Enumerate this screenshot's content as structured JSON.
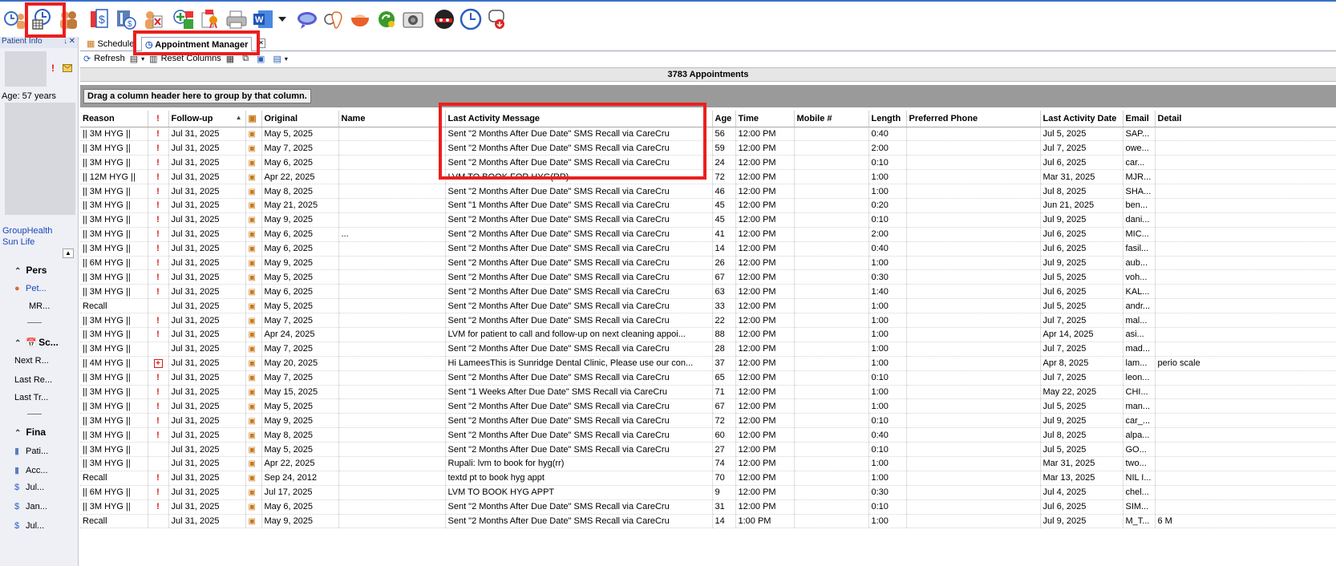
{
  "toolbar": {
    "icons": [
      "clock-person-icon",
      "appointment-manager-icon",
      "patient-icon",
      "billing-icon",
      "insurance-icon",
      "treatment-icon",
      "add-patient-icon",
      "certificate-icon",
      "printer-icon",
      "word-icon",
      "dropdown-icon",
      "chat-icon",
      "tooth-icon",
      "bowl-icon",
      "refresh-icon",
      "camera-icon",
      "mask-icon",
      "clock-icon",
      "phone-icon"
    ]
  },
  "left_panel": {
    "title": "Patient Info",
    "pin": "↓",
    "close": "✕",
    "alert": "!",
    "age": "Age: 57 years",
    "insurance": [
      "GroupHealth",
      "Sun Life"
    ],
    "sections": [
      {
        "label": "Pers",
        "items": [
          {
            "label": "Pet...",
            "link": true,
            "icon": "person-icon"
          },
          {
            "label": "MR...",
            "link": false,
            "icon": ""
          }
        ]
      },
      {
        "label": "Sc...",
        "items": [
          {
            "label": "Next R...",
            "link": false,
            "icon": ""
          },
          {
            "label": "Last Re...",
            "link": false,
            "icon": ""
          },
          {
            "label": "Last Tr...",
            "link": false,
            "icon": ""
          }
        ]
      },
      {
        "label": "Fina",
        "items": [
          {
            "label": "Pati...",
            "link": false,
            "icon": "ledger-icon"
          },
          {
            "label": "Acc...",
            "link": false,
            "icon": "ledger-icon"
          },
          {
            "label": "Jul...",
            "link": false,
            "icon": "statement-icon"
          },
          {
            "label": "Jan...",
            "link": false,
            "icon": "statement-icon"
          },
          {
            "label": "Jul...",
            "link": false,
            "icon": "statement-icon"
          }
        ]
      }
    ]
  },
  "tabs": {
    "schedule": "Schedule",
    "appointment_manager": "Appointment Manager",
    "close": "✕"
  },
  "actions": {
    "refresh": "Refresh",
    "reset_columns": "Reset Columns"
  },
  "count": "3783 Appointments",
  "group_hint": "Drag a column header here to group by that column.",
  "columns": [
    "Reason",
    "!",
    "Follow-up",
    "",
    "Original",
    "Name",
    "Last Activity Message",
    "Age",
    "Time",
    "Mobile #",
    "Length",
    "Preferred Phone",
    "Last Activity Date",
    "Email",
    "Detail"
  ],
  "rows": [
    {
      "reason": "|| 3M HYG ||",
      "flag": "!",
      "followup": "Jul 31, 2025",
      "original": "May 5, 2025",
      "name": "",
      "message": "Sent \"2 Months After Due Date\" SMS Recall via CareCru",
      "age": "56",
      "time": "12:00 PM",
      "mobile": "",
      "length": "0:40",
      "phone": "",
      "last_date": "Jul 5, 2025",
      "email": "SAP...",
      "detail": ""
    },
    {
      "reason": "|| 3M HYG ||",
      "flag": "!",
      "followup": "Jul 31, 2025",
      "original": "May 7, 2025",
      "name": "",
      "message": "Sent \"2 Months After Due Date\" SMS Recall via CareCru",
      "age": "59",
      "time": "12:00 PM",
      "mobile": "",
      "length": "2:00",
      "phone": "",
      "last_date": "Jul 7, 2025",
      "email": "owe...",
      "detail": ""
    },
    {
      "reason": "|| 3M HYG ||",
      "flag": "!",
      "followup": "Jul 31, 2025",
      "original": "May 6, 2025",
      "name": "",
      "message": "Sent \"2 Months After Due Date\" SMS Recall via CareCru",
      "age": "24",
      "time": "12:00 PM",
      "mobile": "",
      "length": "0:10",
      "phone": "",
      "last_date": "Jul 6, 2025",
      "email": "car...",
      "detail": ""
    },
    {
      "reason": "|| 12M HYG ||",
      "flag": "!",
      "followup": "Jul 31, 2025",
      "original": "Apr 22, 2025",
      "name": "",
      "message": "LVM TO BOOK FOR HYG(RR)",
      "age": "72",
      "time": "12:00 PM",
      "mobile": "",
      "length": "1:00",
      "phone": "",
      "last_date": "Mar 31, 2025",
      "email": "MJR...",
      "detail": ""
    },
    {
      "reason": "|| 3M HYG ||",
      "flag": "!",
      "followup": "Jul 31, 2025",
      "original": "May 8, 2025",
      "name": "",
      "message": "Sent \"2 Months After Due Date\" SMS Recall via CareCru",
      "age": "46",
      "time": "12:00 PM",
      "mobile": "",
      "length": "1:00",
      "phone": "",
      "last_date": "Jul 8, 2025",
      "email": "SHA...",
      "detail": ""
    },
    {
      "reason": "|| 3M HYG ||",
      "flag": "!",
      "followup": "Jul 31, 2025",
      "original": "May 21, 2025",
      "name": "",
      "message": "Sent \"1 Months After Due Date\" SMS Recall via CareCru",
      "age": "45",
      "time": "12:00 PM",
      "mobile": "",
      "length": "0:20",
      "phone": "",
      "last_date": "Jun 21, 2025",
      "email": "ben...",
      "detail": ""
    },
    {
      "reason": "|| 3M HYG ||",
      "flag": "!",
      "followup": "Jul 31, 2025",
      "original": "May 9, 2025",
      "name": "",
      "message": "Sent \"2 Months After Due Date\" SMS Recall via CareCru",
      "age": "45",
      "time": "12:00 PM",
      "mobile": "",
      "length": "0:10",
      "phone": "",
      "last_date": "Jul 9, 2025",
      "email": "dani...",
      "detail": ""
    },
    {
      "reason": "|| 3M HYG ||",
      "flag": "!",
      "followup": "Jul 31, 2025",
      "original": "May 6, 2025",
      "name": "...",
      "message": "Sent \"2 Months After Due Date\" SMS Recall via CareCru",
      "age": "41",
      "time": "12:00 PM",
      "mobile": "",
      "length": "2:00",
      "phone": "",
      "last_date": "Jul 6, 2025",
      "email": "MIC...",
      "detail": ""
    },
    {
      "reason": "|| 3M HYG ||",
      "flag": "!",
      "followup": "Jul 31, 2025",
      "original": "May 6, 2025",
      "name": "",
      "message": "Sent \"2 Months After Due Date\" SMS Recall via CareCru",
      "age": "14",
      "time": "12:00 PM",
      "mobile": "",
      "length": "0:40",
      "phone": "",
      "last_date": "Jul 6, 2025",
      "email": "fasil...",
      "detail": ""
    },
    {
      "reason": "|| 6M HYG ||",
      "flag": "!",
      "followup": "Jul 31, 2025",
      "original": "May 9, 2025",
      "name": "",
      "message": "Sent \"2 Months After Due Date\" SMS Recall via CareCru",
      "age": "26",
      "time": "12:00 PM",
      "mobile": "",
      "length": "1:00",
      "phone": "",
      "last_date": "Jul 9, 2025",
      "email": "aub...",
      "detail": ""
    },
    {
      "reason": "|| 3M HYG ||",
      "flag": "!",
      "followup": "Jul 31, 2025",
      "original": "May 5, 2025",
      "name": "",
      "message": "Sent \"2 Months After Due Date\" SMS Recall via CareCru",
      "age": "67",
      "time": "12:00 PM",
      "mobile": "",
      "length": "0:30",
      "phone": "",
      "last_date": "Jul 5, 2025",
      "email": "voh...",
      "detail": ""
    },
    {
      "reason": "|| 3M HYG ||",
      "flag": "!",
      "followup": "Jul 31, 2025",
      "original": "May 6, 2025",
      "name": "",
      "message": "Sent \"2 Months After Due Date\" SMS Recall via CareCru",
      "age": "63",
      "time": "12:00 PM",
      "mobile": "",
      "length": "1:40",
      "phone": "",
      "last_date": "Jul 6, 2025",
      "email": "KAL...",
      "detail": ""
    },
    {
      "reason": "Recall",
      "flag": "",
      "followup": "Jul 31, 2025",
      "original": "May 5, 2025",
      "name": "",
      "message": "Sent \"2 Months After Due Date\" SMS Recall via CareCru",
      "age": "33",
      "time": "12:00 PM",
      "mobile": "",
      "length": "1:00",
      "phone": "",
      "last_date": "Jul 5, 2025",
      "email": "andr...",
      "detail": ""
    },
    {
      "reason": "|| 3M HYG ||",
      "flag": "!",
      "followup": "Jul 31, 2025",
      "original": "May 7, 2025",
      "name": "",
      "message": "Sent \"2 Months After Due Date\" SMS Recall via CareCru",
      "age": "22",
      "time": "12:00 PM",
      "mobile": "",
      "length": "1:00",
      "phone": "",
      "last_date": "Jul 7, 2025",
      "email": "mal...",
      "detail": ""
    },
    {
      "reason": "|| 3M HYG ||",
      "flag": "!",
      "followup": "Jul 31, 2025",
      "original": "Apr 24, 2025",
      "name": "",
      "message": "LVM for patient to call and follow-up on next cleaning appoi...",
      "age": "88",
      "time": "12:00 PM",
      "mobile": "",
      "length": "1:00",
      "phone": "",
      "last_date": "Apr 14, 2025",
      "email": "asi...",
      "detail": ""
    },
    {
      "reason": "|| 3M HYG ||",
      "flag": "",
      "followup": "Jul 31, 2025",
      "original": "May 7, 2025",
      "name": "",
      "message": "Sent \"2 Months After Due Date\" SMS Recall via CareCru",
      "age": "28",
      "time": "12:00 PM",
      "mobile": "",
      "length": "1:00",
      "phone": "",
      "last_date": "Jul 7, 2025",
      "email": "mad...",
      "detail": ""
    },
    {
      "reason": "|| 4M HYG ||",
      "flag": "+",
      "followup": "Jul 31, 2025",
      "original": "May 20, 2025",
      "name": "",
      "message": "Hi LameesThis is Sunridge Dental Clinic, Please use our con...",
      "age": "37",
      "time": "12:00 PM",
      "mobile": "",
      "length": "1:00",
      "phone": "",
      "last_date": "Apr 8, 2025",
      "email": "lam...",
      "detail": "perio scale"
    },
    {
      "reason": "|| 3M HYG ||",
      "flag": "!",
      "followup": "Jul 31, 2025",
      "original": "May 7, 2025",
      "name": "",
      "message": "Sent \"2 Months After Due Date\" SMS Recall via CareCru",
      "age": "65",
      "time": "12:00 PM",
      "mobile": "",
      "length": "0:10",
      "phone": "",
      "last_date": "Jul 7, 2025",
      "email": "leon...",
      "detail": ""
    },
    {
      "reason": "|| 3M HYG ||",
      "flag": "!",
      "followup": "Jul 31, 2025",
      "original": "May 15, 2025",
      "name": "",
      "message": "Sent \"1 Weeks After Due Date\" SMS Recall via CareCru",
      "age": "71",
      "time": "12:00 PM",
      "mobile": "",
      "length": "1:00",
      "phone": "",
      "last_date": "May 22, 2025",
      "email": "CHI...",
      "detail": ""
    },
    {
      "reason": "|| 3M HYG ||",
      "flag": "!",
      "followup": "Jul 31, 2025",
      "original": "May 5, 2025",
      "name": "",
      "message": "Sent \"2 Months After Due Date\" SMS Recall via CareCru",
      "age": "67",
      "time": "12:00 PM",
      "mobile": "",
      "length": "1:00",
      "phone": "",
      "last_date": "Jul 5, 2025",
      "email": "man...",
      "detail": ""
    },
    {
      "reason": "|| 3M HYG ||",
      "flag": "!",
      "followup": "Jul 31, 2025",
      "original": "May 9, 2025",
      "name": "",
      "message": "Sent \"2 Months After Due Date\" SMS Recall via CareCru",
      "age": "72",
      "time": "12:00 PM",
      "mobile": "",
      "length": "0:10",
      "phone": "",
      "last_date": "Jul 9, 2025",
      "email": "car_...",
      "detail": ""
    },
    {
      "reason": "|| 3M HYG ||",
      "flag": "!",
      "followup": "Jul 31, 2025",
      "original": "May 8, 2025",
      "name": "",
      "message": "Sent \"2 Months After Due Date\" SMS Recall via CareCru",
      "age": "60",
      "time": "12:00 PM",
      "mobile": "",
      "length": "0:40",
      "phone": "",
      "last_date": "Jul 8, 2025",
      "email": "alpa...",
      "detail": ""
    },
    {
      "reason": "|| 3M HYG ||",
      "flag": "",
      "followup": "Jul 31, 2025",
      "original": "May 5, 2025",
      "name": "",
      "message": "Sent \"2 Months After Due Date\" SMS Recall via CareCru",
      "age": "27",
      "time": "12:00 PM",
      "mobile": "",
      "length": "0:10",
      "phone": "",
      "last_date": "Jul 5, 2025",
      "email": "GO...",
      "detail": ""
    },
    {
      "reason": "|| 3M HYG ||",
      "flag": "",
      "followup": "Jul 31, 2025",
      "original": "Apr 22, 2025",
      "name": "",
      "message": "Rupali: lvm to book for hyg(rr)",
      "age": "74",
      "time": "12:00 PM",
      "mobile": "",
      "length": "1:00",
      "phone": "",
      "last_date": "Mar 31, 2025",
      "email": "two...",
      "detail": ""
    },
    {
      "reason": "Recall",
      "flag": "!",
      "followup": "Jul 31, 2025",
      "original": "Sep 24, 2012",
      "name": "",
      "message": "textd pt to book hyg appt",
      "age": "70",
      "time": "12:00 PM",
      "mobile": "",
      "length": "1:00",
      "phone": "",
      "last_date": "Mar 13, 2025",
      "email": "NIL I...",
      "detail": ""
    },
    {
      "reason": "|| 6M HYG ||",
      "flag": "!",
      "followup": "Jul 31, 2025",
      "original": "Jul 17, 2025",
      "name": "",
      "message": "LVM TO BOOK HYG APPT",
      "age": "9",
      "time": "12:00 PM",
      "mobile": "",
      "length": "0:30",
      "phone": "",
      "last_date": "Jul 4, 2025",
      "email": "chel...",
      "detail": ""
    },
    {
      "reason": "|| 3M HYG ||",
      "flag": "!",
      "followup": "Jul 31, 2025",
      "original": "May 6, 2025",
      "name": "",
      "message": "Sent \"2 Months After Due Date\" SMS Recall via CareCru",
      "age": "31",
      "time": "12:00 PM",
      "mobile": "",
      "length": "0:10",
      "phone": "",
      "last_date": "Jul 6, 2025",
      "email": "SIM...",
      "detail": ""
    },
    {
      "reason": "Recall",
      "flag": "",
      "followup": "Jul 31, 2025",
      "original": "May 9, 2025",
      "name": "",
      "message": "Sent \"2 Months After Due Date\" SMS Recall via CareCru",
      "age": "14",
      "time": "1:00 PM",
      "mobile": "",
      "length": "1:00",
      "phone": "",
      "last_date": "Jul 9, 2025",
      "email": "M_T...",
      "detail": "6 M"
    }
  ]
}
